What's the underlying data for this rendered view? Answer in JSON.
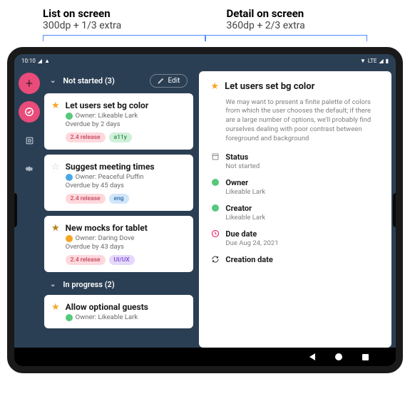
{
  "labels": {
    "list": {
      "title": "List on screen",
      "sub": "300dp + 1/3 extra"
    },
    "detail": {
      "title": "Detail on screen",
      "sub": "360dp + 2/3 extra"
    }
  },
  "statusbar": {
    "time": "10:10",
    "net": "LTE"
  },
  "edit_label": "Edit",
  "sections": {
    "not_started": {
      "label": "Not started (3)"
    },
    "in_progress": {
      "label": "In progress (2)"
    }
  },
  "cards": [
    {
      "title": "Let users set bg color",
      "owner": "Owner: Likeable Lark",
      "overdue": "Overdue by 2 days",
      "chips": [
        "2.4 release",
        "a11y"
      ],
      "chip_classes": [
        "pink",
        "green"
      ],
      "dot": "green",
      "star": "gold"
    },
    {
      "title": "Suggest meeting times",
      "owner": "Owner: Peaceful Puffin",
      "overdue": "Overdue by 45 days",
      "chips": [
        "2.4 release",
        "eng"
      ],
      "chip_classes": [
        "pink",
        "blue"
      ],
      "dot": "blue",
      "star": "open"
    },
    {
      "title": "New mocks for tablet",
      "owner": "Owner: Daring Dove",
      "overdue": "Overdue by 43 days",
      "chips": [
        "2.4 release",
        "UI/UX"
      ],
      "chip_classes": [
        "pink",
        "purple"
      ],
      "dot": "orange",
      "star": "filled"
    },
    {
      "title": "Allow optional guests",
      "owner": "Owner: Likeable Lark",
      "overdue": "",
      "chips": [],
      "chip_classes": [],
      "dot": "green",
      "star": "gold"
    }
  ],
  "detail": {
    "title": "Let users set bg color",
    "desc": "We may want to present a finite palette of colors from which the user chooses the default; if there are a large number of options, we'll probably find ourselves dealing with poor contrast between foreground and background",
    "status": {
      "label": "Status",
      "value": "Not started"
    },
    "owner": {
      "label": "Owner",
      "value": "Likeable Lark"
    },
    "creator": {
      "label": "Creator",
      "value": "Likeable Lark"
    },
    "due": {
      "label": "Due date",
      "value": "Due Aug 24, 2021"
    },
    "creation": {
      "label": "Creation date"
    }
  }
}
